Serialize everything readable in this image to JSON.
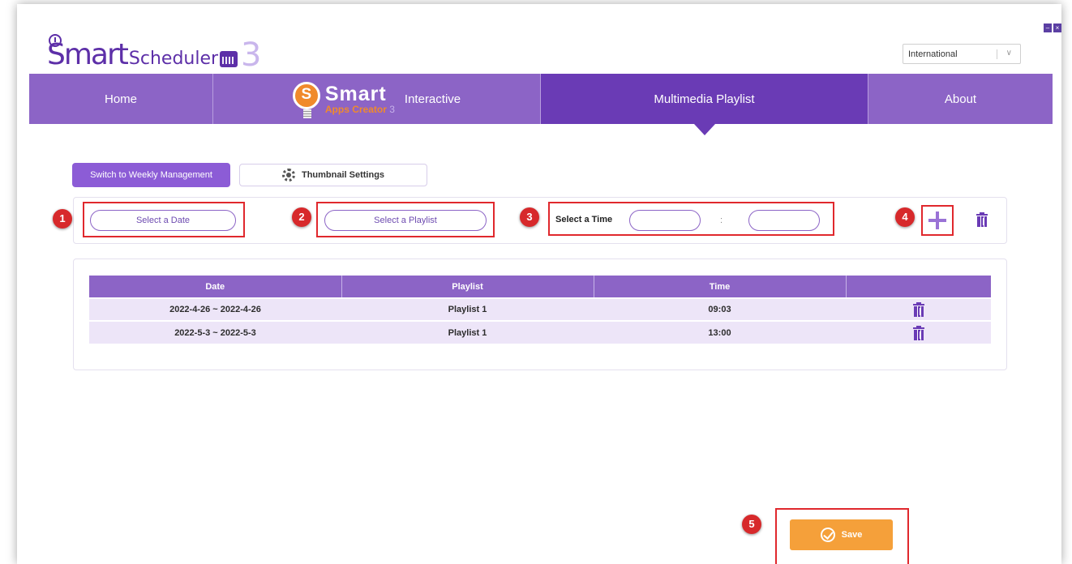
{
  "app": {
    "logo_word": "Smart",
    "logo_sub": "Scheduler",
    "logo_version": "3",
    "language": "International"
  },
  "nav": {
    "items": [
      {
        "label": "Home"
      },
      {
        "label": "Interactive",
        "brand_big": "Smart",
        "brand_small": "Apps Creator",
        "brand_version": "3"
      },
      {
        "label": "Multimedia Playlist",
        "active": true
      },
      {
        "label": "About"
      }
    ]
  },
  "toolbar": {
    "weekly_label": "Switch to Weekly Management",
    "thumbnail_label": "Thumbnail Settings"
  },
  "form": {
    "date_placeholder": "Select a Date",
    "playlist_placeholder": "Select a Playlist",
    "time_label": "Select a Time",
    "time_separator": ":",
    "hour_value": "",
    "minute_value": ""
  },
  "badges": [
    "1",
    "2",
    "3",
    "4",
    "5"
  ],
  "table": {
    "headers": [
      "Date",
      "Playlist",
      "Time",
      ""
    ],
    "rows": [
      {
        "date": "2022-4-26 ~ 2022-4-26",
        "playlist": "Playlist 1",
        "time": "09:03"
      },
      {
        "date": "2022-5-3 ~ 2022-5-3",
        "playlist": "Playlist 1",
        "time": "13:00"
      }
    ]
  },
  "save": {
    "label": "Save"
  },
  "colors": {
    "nav": "#8c64c6",
    "nav_active": "#6a3bb5",
    "accent_button": "#8c5cd6",
    "save": "#f5a03a",
    "highlight": "#e0282d"
  },
  "icons": [
    "clock-icon",
    "calendar-icon",
    "chevron-down-icon",
    "bulb-icon",
    "gear-icon",
    "plus-icon",
    "trash-icon",
    "check-circle-icon"
  ]
}
